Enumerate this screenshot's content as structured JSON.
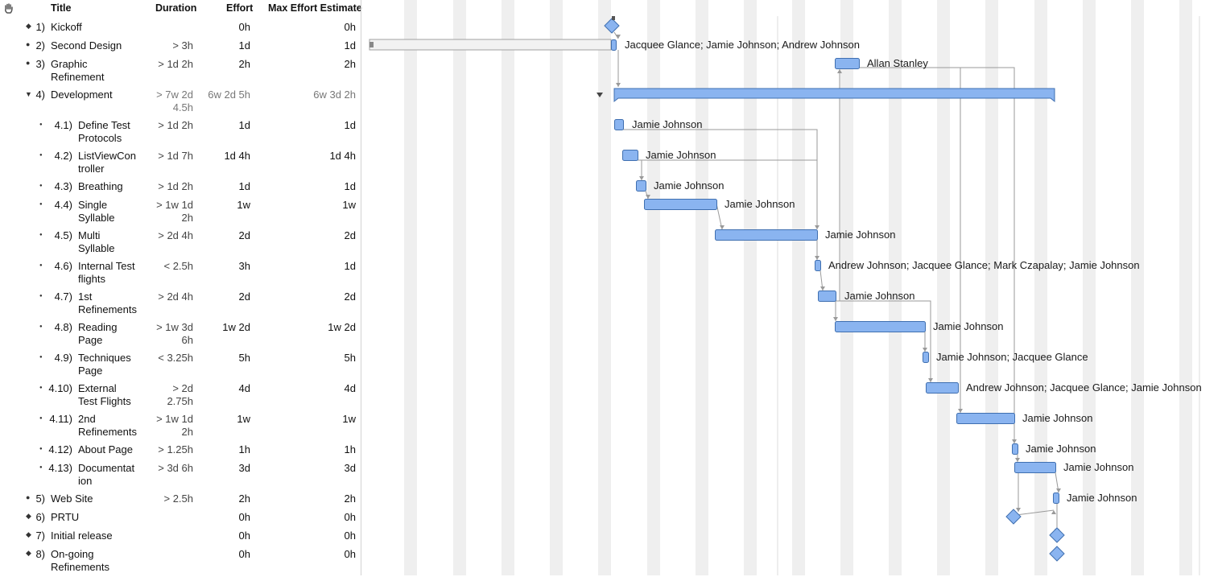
{
  "columns": {
    "title": "Title",
    "duration": "Duration",
    "effort": "Effort",
    "max_effort": "Max Effort Estimate"
  },
  "rows": [
    {
      "num": "1)",
      "title": [
        "Kickoff"
      ],
      "duration": [],
      "effort": "0h",
      "max": "0h",
      "milestone": true
    },
    {
      "num": "2)",
      "title": [
        "Second Design"
      ],
      "duration": [
        "> 3h"
      ],
      "effort": "1d",
      "max": "1d"
    },
    {
      "num": "3)",
      "title": [
        "Graphic",
        "Refinement"
      ],
      "duration": [
        "> 1d 2h"
      ],
      "effort": "2h",
      "max": "2h"
    },
    {
      "num": "4)",
      "title": [
        "Development"
      ],
      "duration": [
        "> 7w 2d",
        "4.5h"
      ],
      "effort": "6w 2d 5h",
      "max": "6w 3d 2h",
      "group": true
    },
    {
      "num": "4.1)",
      "title": [
        "Define Test",
        "Protocols"
      ],
      "duration": [
        "> 1d 2h"
      ],
      "effort": "1d",
      "max": "1d",
      "child": true
    },
    {
      "num": "4.2)",
      "title": [
        "ListViewCon",
        "troller"
      ],
      "duration": [
        "> 1d 7h"
      ],
      "effort": "1d 4h",
      "max": "1d 4h",
      "child": true
    },
    {
      "num": "4.3)",
      "title": [
        "Breathing"
      ],
      "duration": [
        "> 1d 2h"
      ],
      "effort": "1d",
      "max": "1d",
      "child": true
    },
    {
      "num": "4.4)",
      "title": [
        "Single",
        "Syllable"
      ],
      "duration": [
        "> 1w 1d",
        "2h"
      ],
      "effort": "1w",
      "max": "1w",
      "child": true
    },
    {
      "num": "4.5)",
      "title": [
        "Multi",
        "Syllable"
      ],
      "duration": [
        "> 2d 4h"
      ],
      "effort": "2d",
      "max": "2d",
      "child": true
    },
    {
      "num": "4.6)",
      "title": [
        "Internal Test",
        "flights"
      ],
      "duration": [
        "< 2.5h"
      ],
      "effort": "3h",
      "max": "1d",
      "child": true
    },
    {
      "num": "4.7)",
      "title": [
        "1st",
        "Refinements"
      ],
      "duration": [
        "> 2d 4h"
      ],
      "effort": "2d",
      "max": "2d",
      "child": true
    },
    {
      "num": "4.8)",
      "title": [
        "Reading",
        "Page"
      ],
      "duration": [
        "> 1w 3d",
        "6h"
      ],
      "effort": "1w 2d",
      "max": "1w 2d",
      "child": true
    },
    {
      "num": "4.9)",
      "title": [
        "Techniques",
        "Page"
      ],
      "duration": [
        "< 3.25h"
      ],
      "effort": "5h",
      "max": "5h",
      "child": true
    },
    {
      "num": "4.10)",
      "title": [
        "External",
        "Test Flights"
      ],
      "duration": [
        "> 2d",
        "2.75h"
      ],
      "effort": "4d",
      "max": "4d",
      "child": true
    },
    {
      "num": "4.11)",
      "title": [
        "2nd",
        "Refinements"
      ],
      "duration": [
        "> 1w 1d",
        "2h"
      ],
      "effort": "1w",
      "max": "1w",
      "child": true
    },
    {
      "num": "4.12)",
      "title": [
        "About Page"
      ],
      "duration": [
        "> 1.25h"
      ],
      "effort": "1h",
      "max": "1h",
      "child": true
    },
    {
      "num": "4.13)",
      "title": [
        "Documentat",
        "ion"
      ],
      "duration": [
        "> 3d 6h"
      ],
      "effort": "3d",
      "max": "3d",
      "child": true
    },
    {
      "num": "5)",
      "title": [
        "Web Site"
      ],
      "duration": [
        "> 2.5h"
      ],
      "effort": "2h",
      "max": "2h"
    },
    {
      "num": "6)",
      "title": [
        "PRTU"
      ],
      "duration": [],
      "effort": "0h",
      "max": "0h",
      "milestone": true
    },
    {
      "num": "7)",
      "title": [
        "Initial release"
      ],
      "duration": [],
      "effort": "0h",
      "max": "0h",
      "milestone": true
    },
    {
      "num": "8)",
      "title": [
        "On-going",
        "Refinements"
      ],
      "duration": [],
      "effort": "0h",
      "max": "0h",
      "milestone": true
    }
  ],
  "gantt": {
    "resources": [
      "",
      "Jacquee Glance; Jamie Johnson; Andrew Johnson",
      "Allan Stanley",
      "",
      "Jamie Johnson",
      "Jamie Johnson",
      "Jamie Johnson",
      "Jamie Johnson",
      "Jamie Johnson",
      "Andrew Johnson; Jacquee Glance; Mark Czapalay; Jamie Johnson",
      "Jamie Johnson",
      "Jamie Johnson",
      "Jamie Johnson; Jacquee Glance",
      "Andrew Johnson; Jacquee Glance; Jamie Johnson",
      "Jamie Johnson",
      "Jamie Johnson",
      "Jamie Johnson",
      "Jamie Johnson",
      "",
      "",
      ""
    ],
    "bar_color": "#8ab4f0",
    "bar_border": "#3f6fb0",
    "stripe_color": "#efefef"
  }
}
